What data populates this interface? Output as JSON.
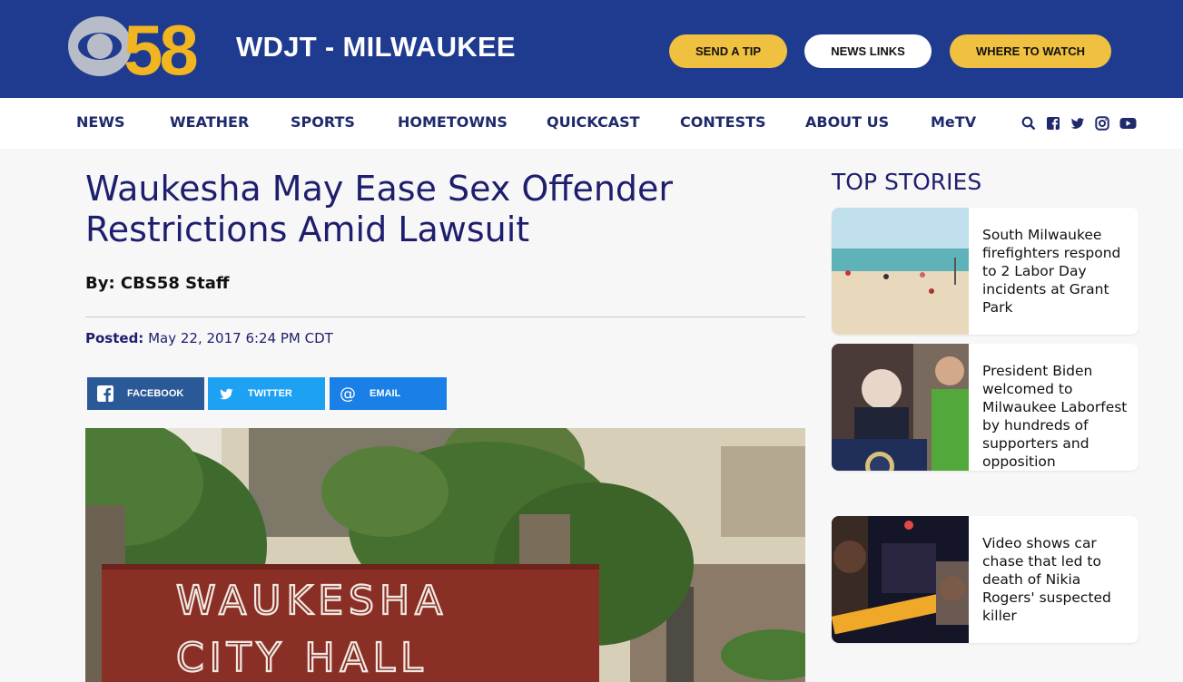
{
  "header": {
    "logo_text": "58",
    "site_title": "WDJT - MILWAUKEE",
    "buttons": {
      "send_tip": "SEND A TIP",
      "news_links": "NEWS LINKS",
      "where_to_watch": "WHERE TO WATCH"
    },
    "colors": {
      "brand": "#1f3b8f",
      "accent": "#f0c040"
    }
  },
  "nav": {
    "items": [
      "NEWS",
      "WEATHER",
      "SPORTS",
      "HOMETOWNS",
      "QUICKCAST",
      "CONTESTS",
      "ABOUT US",
      "MeTV"
    ],
    "icons": [
      "search-icon",
      "facebook-icon",
      "twitter-icon",
      "instagram-icon",
      "youtube-icon"
    ]
  },
  "article": {
    "headline": "Waukesha May Ease Sex Offender Restrictions Amid Lawsuit",
    "byline": "By: CBS58 Staff",
    "posted_label": "Posted:",
    "posted_date": "May 22, 2017 6:24 PM CDT",
    "share": {
      "facebook": "FACEBOOK",
      "twitter": "TWITTER",
      "email": "EMAIL"
    },
    "hero_sign": {
      "line1": "WAUKESHA",
      "line2": "CITY HALL"
    }
  },
  "sidebar": {
    "title": "TOP STORIES",
    "stories": [
      {
        "text": "South Milwaukee firefighters respond to 2 Labor Day incidents at Grant Park"
      },
      {
        "text": "President Biden welcomed to Milwaukee Laborfest by hundreds of supporters and opposition"
      },
      {
        "text": "Video shows car chase that led to death of Nikia Rogers' suspected killer"
      }
    ]
  }
}
